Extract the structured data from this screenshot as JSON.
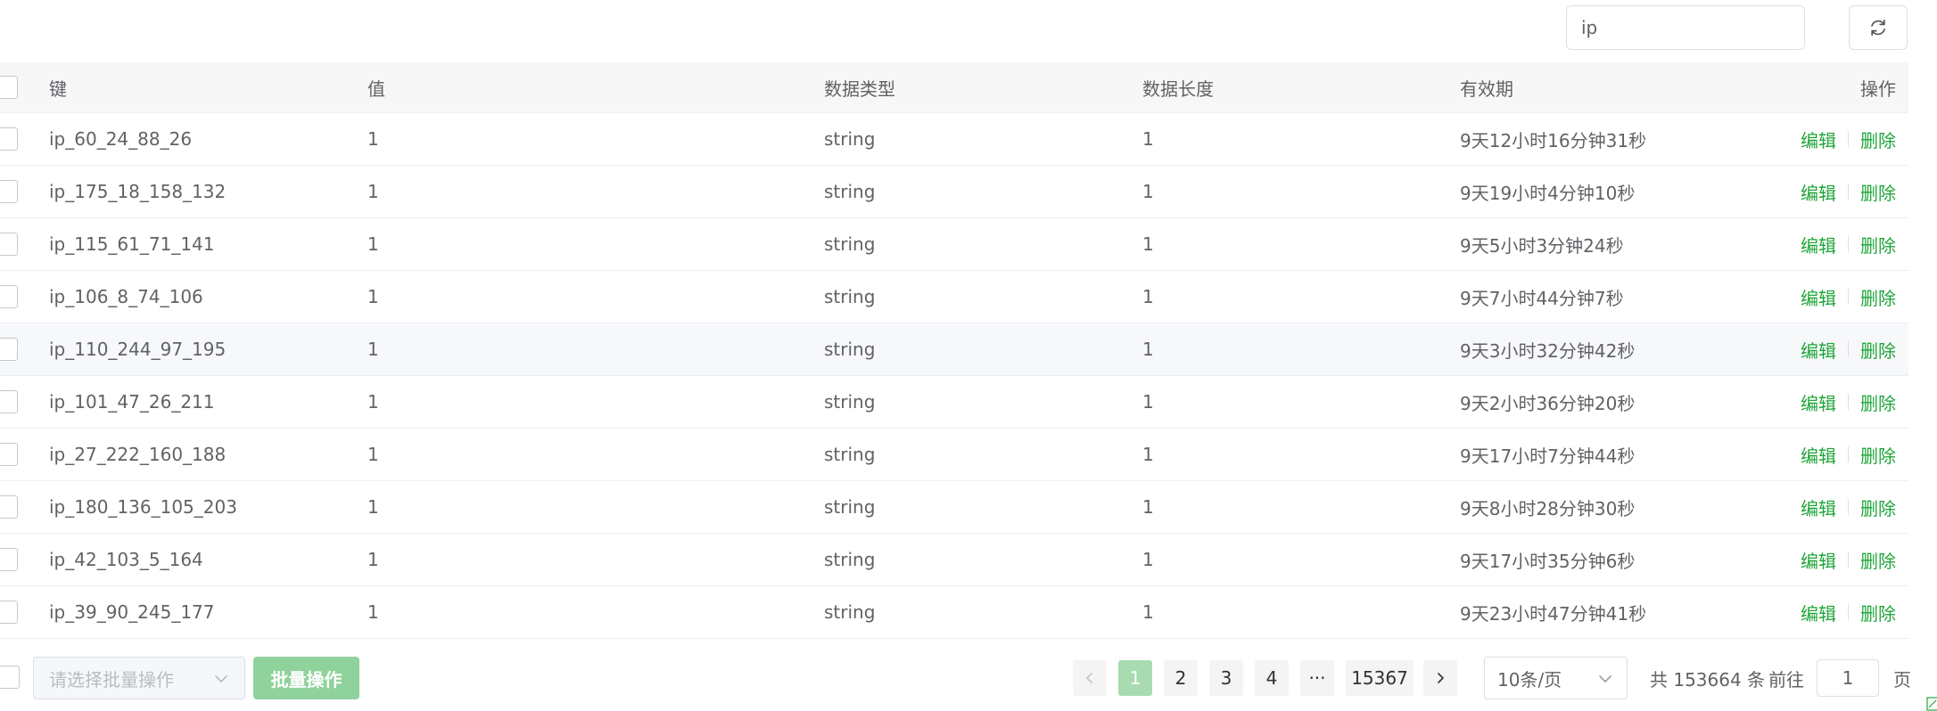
{
  "search": {
    "value": "ip"
  },
  "table": {
    "headers": {
      "key": "键",
      "value": "值",
      "type": "数据类型",
      "length": "数据长度",
      "ttl": "有效期",
      "actions": "操作"
    },
    "rows": [
      {
        "key": "ip_60_24_88_26",
        "value": "1",
        "type": "string",
        "length": "1",
        "ttl": "9天12小时16分钟31秒"
      },
      {
        "key": "ip_175_18_158_132",
        "value": "1",
        "type": "string",
        "length": "1",
        "ttl": "9天19小时4分钟10秒"
      },
      {
        "key": "ip_115_61_71_141",
        "value": "1",
        "type": "string",
        "length": "1",
        "ttl": "9天5小时3分钟24秒"
      },
      {
        "key": "ip_106_8_74_106",
        "value": "1",
        "type": "string",
        "length": "1",
        "ttl": "9天7小时44分钟7秒"
      },
      {
        "key": "ip_110_244_97_195",
        "value": "1",
        "type": "string",
        "length": "1",
        "ttl": "9天3小时32分钟42秒"
      },
      {
        "key": "ip_101_47_26_211",
        "value": "1",
        "type": "string",
        "length": "1",
        "ttl": "9天2小时36分钟20秒"
      },
      {
        "key": "ip_27_222_160_188",
        "value": "1",
        "type": "string",
        "length": "1",
        "ttl": "9天17小时7分钟44秒"
      },
      {
        "key": "ip_180_136_105_203",
        "value": "1",
        "type": "string",
        "length": "1",
        "ttl": "9天8小时28分钟30秒"
      },
      {
        "key": "ip_42_103_5_164",
        "value": "1",
        "type": "string",
        "length": "1",
        "ttl": "9天17小时35分钟6秒"
      },
      {
        "key": "ip_39_90_245_177",
        "value": "1",
        "type": "string",
        "length": "1",
        "ttl": "9天23小时47分钟41秒"
      }
    ],
    "edit_label": "编辑",
    "delete_label": "删除"
  },
  "footer": {
    "batch_placeholder": "请选择批量操作",
    "batch_button": "批量操作",
    "pages": [
      "1",
      "2",
      "3",
      "4",
      "15367"
    ],
    "ellipsis": "···",
    "current_page": "1",
    "page_size": "10条/页",
    "total": "共 153664 条",
    "goto_label": "前往",
    "goto_value": "1",
    "page_unit": "页"
  },
  "colors": {
    "accent": "#20a53a",
    "active_page_bg": "#a8dcb0",
    "batch_button_bg": "#90d29c",
    "header_bg": "#f7f7f7",
    "hover_row_bg": "#f7f8fa"
  },
  "icons": [
    "search-icon",
    "refresh-icon",
    "chevron-down-icon",
    "chevron-left-icon",
    "chevron-right-icon",
    "corner-icon"
  ]
}
